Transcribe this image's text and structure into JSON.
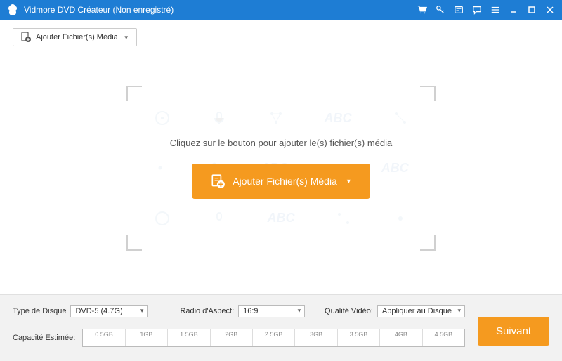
{
  "titlebar": {
    "title": "Vidmore DVD Créateur (Non enregistré)"
  },
  "toolbar": {
    "add_label": "Ajouter Fichier(s) Média"
  },
  "dropzone": {
    "prompt": "Cliquez sur le bouton pour ajouter le(s) fichier(s) média",
    "add_label": "Ajouter Fichier(s) Média"
  },
  "footer": {
    "disc_type_label": "Type de Disque",
    "disc_type_value": "DVD-5 (4.7G)",
    "aspect_label": "Radio d'Aspect:",
    "aspect_value": "16:9",
    "quality_label": "Qualité Vidéo:",
    "quality_value": "Appliquer au Disque",
    "capacity_label": "Capacité Estimée:",
    "ticks": [
      "0.5GB",
      "1GB",
      "1.5GB",
      "2GB",
      "2.5GB",
      "3GB",
      "3.5GB",
      "4GB",
      "4.5GB"
    ],
    "next_label": "Suivant"
  }
}
